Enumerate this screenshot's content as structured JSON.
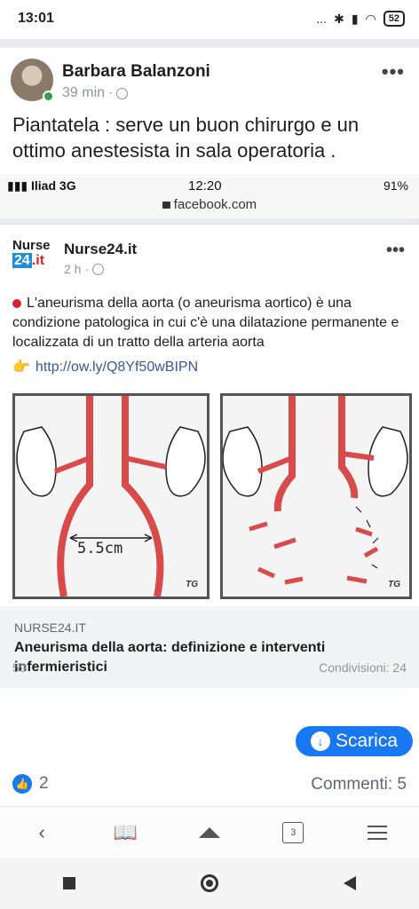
{
  "statusbar": {
    "time": "13:01",
    "signal": "...",
    "battery": "52"
  },
  "post": {
    "author": "Barbara Balanzoni",
    "time": "39 min",
    "separator": "·",
    "text": "Piantatela : serve un buon chirurgo e un ottimo anestesista in sala operatoria ."
  },
  "screenshot": {
    "carrier": "Iliad",
    "network": "3G",
    "clock": "12:20",
    "battery": "91%",
    "url": "facebook.com",
    "page": {
      "logo_top": "Nurse",
      "logo_num": "24",
      "logo_suffix": ".it",
      "name": "Nurse24.it",
      "time": "2 h",
      "separator": "·",
      "text": "L'aneurisma della aorta (o aneurisma aortico) è una condizione patologica in cui c'è una dilatazione permanente e localizzata di un tratto della arteria aorta",
      "link": "http://ow.ly/Q8Yf50wBIPN",
      "hand": "👉",
      "image_label": "5.5cm",
      "image_signature": "TG",
      "preview_domain": "NURSE24.IT",
      "preview_title": "Aneurisma della aorta: definizione e interventi infermieristici",
      "cut_left": "59",
      "cut_right": "Condivisioni: 24"
    }
  },
  "download_label": "Scarica",
  "reactions_count": "2",
  "comments": "Commenti: 5",
  "toolbar": {
    "tabs_count": "3"
  }
}
